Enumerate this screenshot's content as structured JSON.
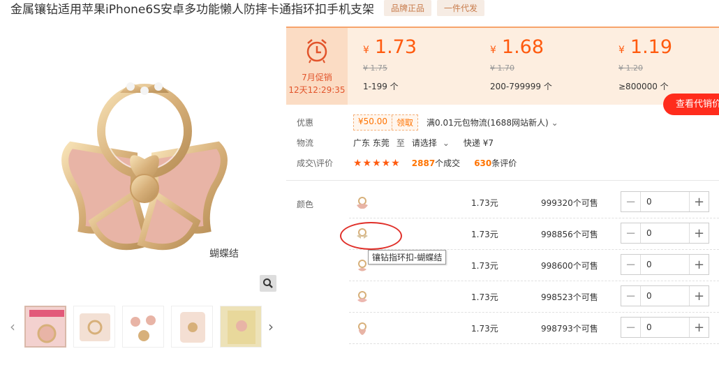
{
  "product": {
    "title": "金属镶钻适用苹果iPhone6S安卓多功能懒人防摔卡通指环扣手机支架",
    "tags": [
      "品牌正品",
      "一件代发"
    ],
    "image_caption": "蝴蝶结"
  },
  "promo": {
    "month": "7月促销",
    "countdown": "12天12:29:35"
  },
  "price_tiers": [
    {
      "currency": "¥",
      "price": "1.73",
      "old": "¥ 1.75",
      "qty": "1-199 个"
    },
    {
      "currency": "¥",
      "price": "1.68",
      "old": "¥ 1.70",
      "qty": "200-799999 个"
    },
    {
      "currency": "¥",
      "price": "1.19",
      "old": "¥ 1.20",
      "qty": "≥800000 个"
    }
  ],
  "agent_button": "查看代销价",
  "discount": {
    "label": "优惠",
    "coupon_amount": "¥50.00",
    "coupon_action": "领取",
    "promo_text": "满0.01元包物流(1688网站新人)"
  },
  "shipping": {
    "label": "物流",
    "origin": "广东 东莞",
    "to": "至",
    "dest": "请选择",
    "method": "快递 ¥7"
  },
  "reviews": {
    "label": "成交\\评价",
    "stars": "★★★★★",
    "deals_count": "2887",
    "deals_suffix": "个成交",
    "reviews_count": "630",
    "reviews_suffix": "条评价"
  },
  "sku": {
    "label": "颜色",
    "tooltip": "镶钻指环扣-蝴蝶结",
    "rows": [
      {
        "price": "1.73元",
        "stock": "999320个可售",
        "qty": "0"
      },
      {
        "price": "1.73元",
        "stock": "998856个可售",
        "qty": "0"
      },
      {
        "price": "1.73元",
        "stock": "998600个可售",
        "qty": "0"
      },
      {
        "price": "1.73元",
        "stock": "998523个可售",
        "qty": "0"
      },
      {
        "price": "1.73元",
        "stock": "998793个可售",
        "qty": "0"
      }
    ]
  },
  "colors": {
    "accent": "#ff5a0e",
    "agent_red": "#ff2c1c",
    "panel_bg": "#fdeee0"
  }
}
